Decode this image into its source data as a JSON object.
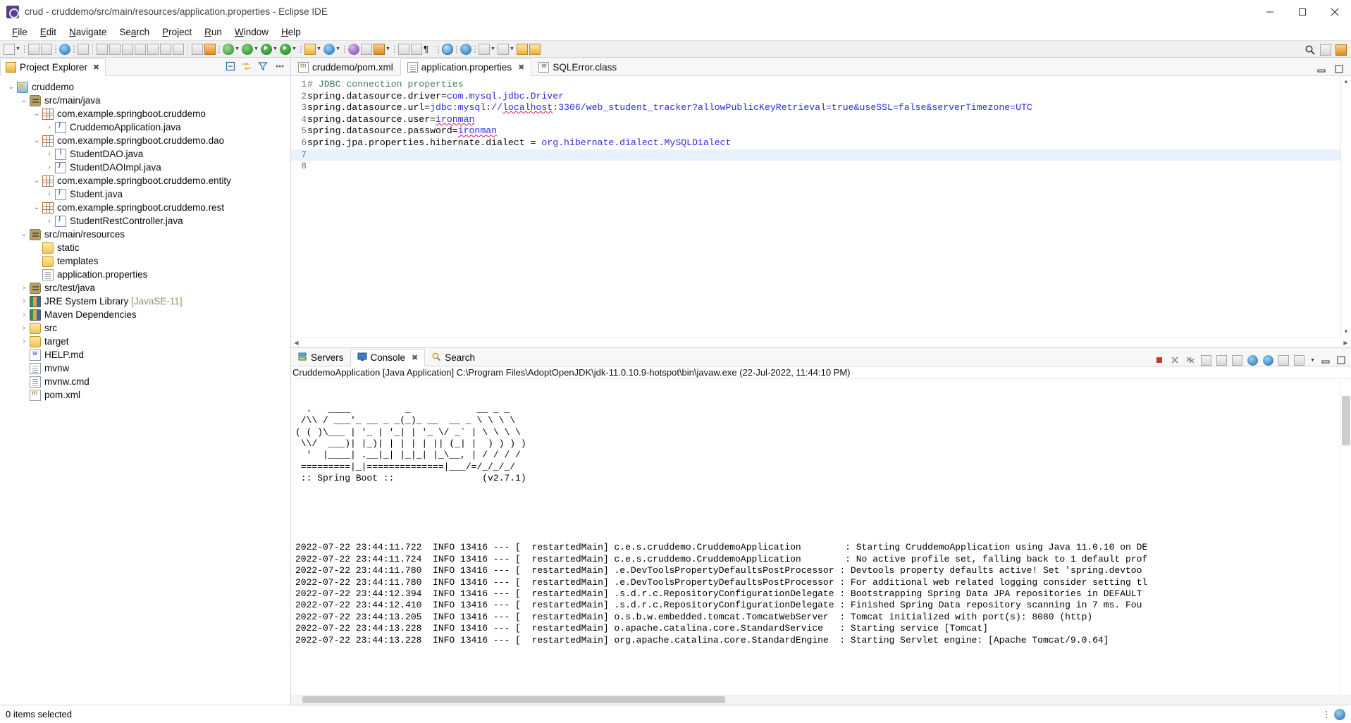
{
  "window": {
    "title": "crud - cruddemo/src/main/resources/application.properties - Eclipse IDE",
    "app_icon": "eclipse-icon",
    "minimize": "–",
    "maximize": "☐",
    "close": "✕"
  },
  "menubar": {
    "items": [
      "File",
      "Edit",
      "Navigate",
      "Search",
      "Project",
      "Run",
      "Window",
      "Help"
    ]
  },
  "toolbar": {
    "search_icon": "search-icon",
    "perspective_java_icon": "java-perspective-icon",
    "perspective_open_icon": "open-perspective-icon"
  },
  "project_explorer": {
    "tab_label": "Project Explorer",
    "tab_close": "✖",
    "actions": [
      "collapse-all-icon",
      "link-with-editor-icon",
      "view-filter-icon",
      "view-menu-icon"
    ],
    "tree": [
      {
        "indent": 0,
        "twist": "v",
        "icon": "project-icon",
        "label": "cruddemo",
        "dim": ""
      },
      {
        "indent": 1,
        "twist": "v",
        "icon": "source-folder-icon",
        "label": "src/main/java",
        "dim": ""
      },
      {
        "indent": 2,
        "twist": "v",
        "icon": "package-icon",
        "label": "com.example.springboot.cruddemo",
        "dim": ""
      },
      {
        "indent": 3,
        "twist": ">",
        "icon": "java-file-icon",
        "label": "CruddemoApplication.java",
        "dim": ""
      },
      {
        "indent": 2,
        "twist": "v",
        "icon": "package-icon",
        "label": "com.example.springboot.cruddemo.dao",
        "dim": ""
      },
      {
        "indent": 3,
        "twist": ">",
        "icon": "java-interface-icon",
        "label": "StudentDAO.java",
        "dim": ""
      },
      {
        "indent": 3,
        "twist": ">",
        "icon": "java-file-icon",
        "label": "StudentDAOImpl.java",
        "dim": ""
      },
      {
        "indent": 2,
        "twist": "v",
        "icon": "package-icon",
        "label": "com.example.springboot.cruddemo.entity",
        "dim": ""
      },
      {
        "indent": 3,
        "twist": ">",
        "icon": "java-file-icon",
        "label": "Student.java",
        "dim": ""
      },
      {
        "indent": 2,
        "twist": "v",
        "icon": "package-icon",
        "label": "com.example.springboot.cruddemo.rest",
        "dim": ""
      },
      {
        "indent": 3,
        "twist": ">",
        "icon": "java-file-icon",
        "label": "StudentRestController.java",
        "dim": ""
      },
      {
        "indent": 1,
        "twist": "v",
        "icon": "source-folder-icon",
        "label": "src/main/resources",
        "dim": ""
      },
      {
        "indent": 2,
        "twist": "",
        "icon": "folder-icon",
        "label": "static",
        "dim": ""
      },
      {
        "indent": 2,
        "twist": "",
        "icon": "folder-icon",
        "label": "templates",
        "dim": ""
      },
      {
        "indent": 2,
        "twist": "",
        "icon": "file-icon",
        "label": "application.properties",
        "dim": ""
      },
      {
        "indent": 1,
        "twist": ">",
        "icon": "source-folder-icon",
        "label": "src/test/java",
        "dim": ""
      },
      {
        "indent": 1,
        "twist": ">",
        "icon": "library-icon",
        "label": "JRE System Library ",
        "dim": "[JavaSE-11]"
      },
      {
        "indent": 1,
        "twist": ">",
        "icon": "library-icon",
        "label": "Maven Dependencies",
        "dim": ""
      },
      {
        "indent": 1,
        "twist": ">",
        "icon": "folder-icon",
        "label": "src",
        "dim": ""
      },
      {
        "indent": 1,
        "twist": ">",
        "icon": "folder-icon",
        "label": "target",
        "dim": ""
      },
      {
        "indent": 1,
        "twist": "",
        "icon": "markdown-file-icon",
        "label": "HELP.md",
        "dim": ""
      },
      {
        "indent": 1,
        "twist": "",
        "icon": "file-icon",
        "label": "mvnw",
        "dim": ""
      },
      {
        "indent": 1,
        "twist": "",
        "icon": "file-icon",
        "label": "mvnw.cmd",
        "dim": ""
      },
      {
        "indent": 1,
        "twist": "",
        "icon": "pom-file-icon",
        "label": "pom.xml",
        "dim": ""
      }
    ]
  },
  "editor": {
    "tabs": [
      {
        "label": "cruddemo/pom.xml",
        "icon": "maven-file-icon",
        "active": false,
        "close": ""
      },
      {
        "label": "application.properties",
        "icon": "properties-file-icon",
        "active": true,
        "close": "✖"
      },
      {
        "label": "SQLError.class",
        "icon": "class-file-icon",
        "active": false,
        "close": ""
      }
    ],
    "lines": [
      {
        "no": "1",
        "highlight": false,
        "segments": [
          {
            "text": "# JDBC connection properties",
            "style": "comment"
          }
        ]
      },
      {
        "no": "2",
        "highlight": false,
        "segments": [
          {
            "text": "spring.datasource.driver=",
            "style": "key"
          },
          {
            "text": "com.mysql.jdbc.Driver",
            "style": "value"
          }
        ]
      },
      {
        "no": "3",
        "highlight": false,
        "segments": [
          {
            "text": "spring.datasource.url=",
            "style": "key"
          },
          {
            "text": "jdbc:mysql://",
            "style": "value"
          },
          {
            "text": "localhost",
            "style": "value-squiggle"
          },
          {
            "text": ":3306/web_student_tracker?allowPublicKeyRetrieval=true&useSSL=false&serverTimezone=UTC",
            "style": "value"
          }
        ]
      },
      {
        "no": "4",
        "highlight": false,
        "segments": [
          {
            "text": "spring.datasource.user=",
            "style": "key"
          },
          {
            "text": "ironman",
            "style": "value-squiggle"
          }
        ]
      },
      {
        "no": "5",
        "highlight": false,
        "segments": [
          {
            "text": "spring.datasource.password=",
            "style": "key"
          },
          {
            "text": "ironman",
            "style": "value-squiggle"
          }
        ]
      },
      {
        "no": "6",
        "highlight": false,
        "segments": [
          {
            "text": "spring.jpa.properties.hibernate.dialect = ",
            "style": "key"
          },
          {
            "text": "org.hibernate.dialect.MySQLDialect",
            "style": "value"
          }
        ]
      },
      {
        "no": "7",
        "highlight": true,
        "segments": [
          {
            "text": "",
            "style": "key"
          }
        ]
      },
      {
        "no": "8",
        "highlight": false,
        "segments": [
          {
            "text": "",
            "style": "key"
          }
        ]
      }
    ]
  },
  "console": {
    "tabs": [
      {
        "label": "Servers",
        "icon": "servers-icon",
        "active": false,
        "close": ""
      },
      {
        "label": "Console",
        "icon": "console-icon",
        "active": true,
        "close": "✖"
      },
      {
        "label": "Search",
        "icon": "search-tab-icon",
        "active": false,
        "close": ""
      }
    ],
    "actions": [
      "terminate-icon",
      "remove-launch-icon",
      "remove-all-icon",
      "show-console-icon",
      "pin-console-icon",
      "new-console-icon",
      "word-wrap-icon",
      "scroll-lock-icon",
      "display-selected-icon",
      "open-console-icon",
      "minimize-icon",
      "maximize-icon"
    ],
    "launch_header": "CruddemoApplication [Java Application] C:\\Program Files\\AdoptOpenJDK\\jdk-11.0.10.9-hotspot\\bin\\javaw.exe  (22-Jul-2022, 11:44:10 PM)",
    "banner": [
      "  .   ____          _            __ _ _",
      " /\\\\ / ___'_ __ _ _(_)_ __  __ _ \\ \\ \\ \\",
      "( ( )\\___ | '_ | '_| | '_ \\/ _` | \\ \\ \\ \\",
      " \\\\/  ___)| |_)| | | | | || (_| |  ) ) ) )",
      "  '  |____| .__|_| |_|_| |_\\__, | / / / /",
      " =========|_|==============|___/=/_/_/_/",
      " :: Spring Boot ::                (v2.7.1)"
    ],
    "log_lines": [
      "2022-07-22 23:44:11.722  INFO 13416 --- [  restartedMain] c.e.s.cruddemo.CruddemoApplication        : Starting CruddemoApplication using Java 11.0.10 on DE",
      "2022-07-22 23:44:11.724  INFO 13416 --- [  restartedMain] c.e.s.cruddemo.CruddemoApplication        : No active profile set, falling back to 1 default prof",
      "2022-07-22 23:44:11.780  INFO 13416 --- [  restartedMain] .e.DevToolsPropertyDefaultsPostProcessor : Devtools property defaults active! Set 'spring.devtoo",
      "2022-07-22 23:44:11.780  INFO 13416 --- [  restartedMain] .e.DevToolsPropertyDefaultsPostProcessor : For additional web related logging consider setting tl",
      "2022-07-22 23:44:12.394  INFO 13416 --- [  restartedMain] .s.d.r.c.RepositoryConfigurationDelegate : Bootstrapping Spring Data JPA repositories in DEFAULT",
      "2022-07-22 23:44:12.410  INFO 13416 --- [  restartedMain] .s.d.r.c.RepositoryConfigurationDelegate : Finished Spring Data repository scanning in 7 ms. Fou",
      "2022-07-22 23:44:13.205  INFO 13416 --- [  restartedMain] o.s.b.w.embedded.tomcat.TomcatWebServer  : Tomcat initialized with port(s): 8080 (http)",
      "2022-07-22 23:44:13.228  INFO 13416 --- [  restartedMain] o.apache.catalina.core.StandardService   : Starting service [Tomcat]",
      "2022-07-22 23:44:13.228  INFO 13416 --- [  restartedMain] org.apache.catalina.core.StandardEngine  : Starting Servlet engine: [Apache Tomcat/9.0.64]"
    ]
  },
  "statusbar": {
    "selection_text": "0 items selected",
    "right_icons": [
      "writable-indicator",
      "notification-icon"
    ]
  }
}
